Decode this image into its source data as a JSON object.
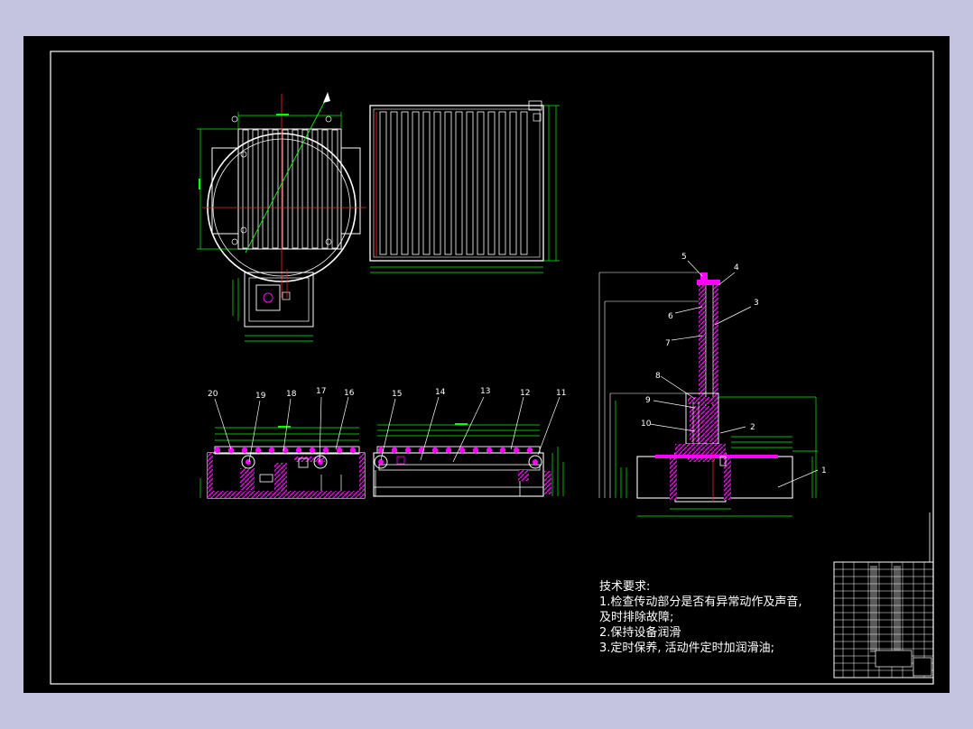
{
  "balloons": [
    "1",
    "2",
    "3",
    "4",
    "5",
    "6",
    "7",
    "8",
    "9",
    "10",
    "11",
    "12",
    "13",
    "14",
    "15",
    "16",
    "17",
    "18",
    "19",
    "20"
  ],
  "technical_requirements": {
    "title": "技术要求:",
    "lines": [
      "1.检查传动部分是否有异常动作及声音,",
      "及时排除故障;",
      "2.保持设备润滑",
      "3.定时保养, 活动件定时加润滑油;"
    ]
  },
  "colors": {
    "background": "#c4c4e0",
    "sheet": "#000000",
    "frame": "#ffffff",
    "outline": "#ffffff",
    "dimension": "#00ff00",
    "centerline": "#ff2020",
    "section": "#ff00ff",
    "hatch": "#ff00ff"
  },
  "icons": [
    "rotation-arrow-icon"
  ]
}
